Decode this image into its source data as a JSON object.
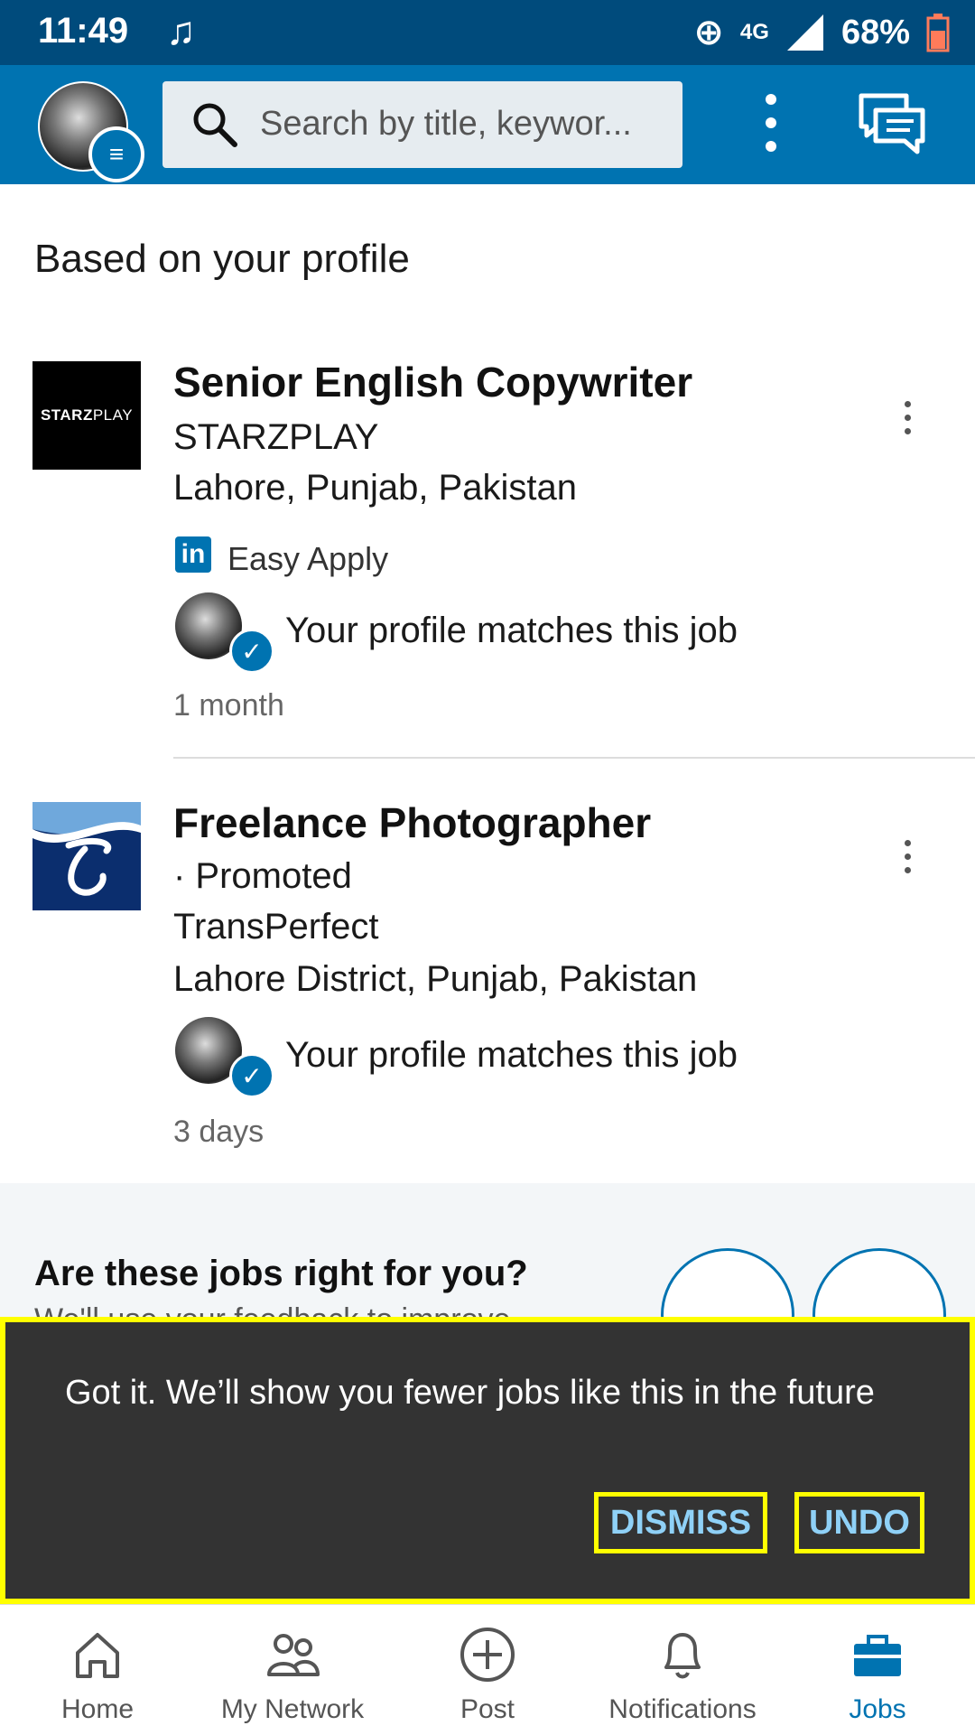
{
  "status_bar": {
    "time": "11:49",
    "network": "4G",
    "battery": "68%"
  },
  "header": {
    "search_placeholder": "Search by title, keywor..."
  },
  "section_title": "Based on your profile",
  "jobs": [
    {
      "logo_text_bold": "STARZ",
      "logo_text_light": "PLAY",
      "title": "Senior English Copywriter",
      "company": "STARZPLAY",
      "location": "Lahore, Punjab, Pakistan",
      "easy_apply": "Easy Apply",
      "match_text": "Your profile matches this job",
      "posted": "1 month"
    },
    {
      "promoted": "· Promoted",
      "title": "Freelance Photographer",
      "company": "TransPerfect",
      "location": "Lahore District, Punjab, Pakistan",
      "match_text": "Your profile matches this job",
      "posted": "3 days"
    }
  ],
  "feedback": {
    "question": "Are these jobs right for you?",
    "subtext": "We'll use your feedback to improve"
  },
  "snackbar": {
    "message": "Got it. We’ll show you fewer jobs like this in the future",
    "dismiss_label": "DISMISS",
    "undo_label": "UNDO"
  },
  "bottom_nav": [
    {
      "label": "Home",
      "icon": "home-icon"
    },
    {
      "label": "My Network",
      "icon": "network-icon"
    },
    {
      "label": "Post",
      "icon": "post-icon"
    },
    {
      "label": "Notifications",
      "icon": "bell-icon"
    },
    {
      "label": "Jobs",
      "icon": "briefcase-icon",
      "active": true
    }
  ],
  "colors": {
    "brand": "#0073b1",
    "status_bar": "#004b7c",
    "snackbar": "#333333",
    "highlight": "#ffff00",
    "snack_action": "#8fd1f7"
  }
}
